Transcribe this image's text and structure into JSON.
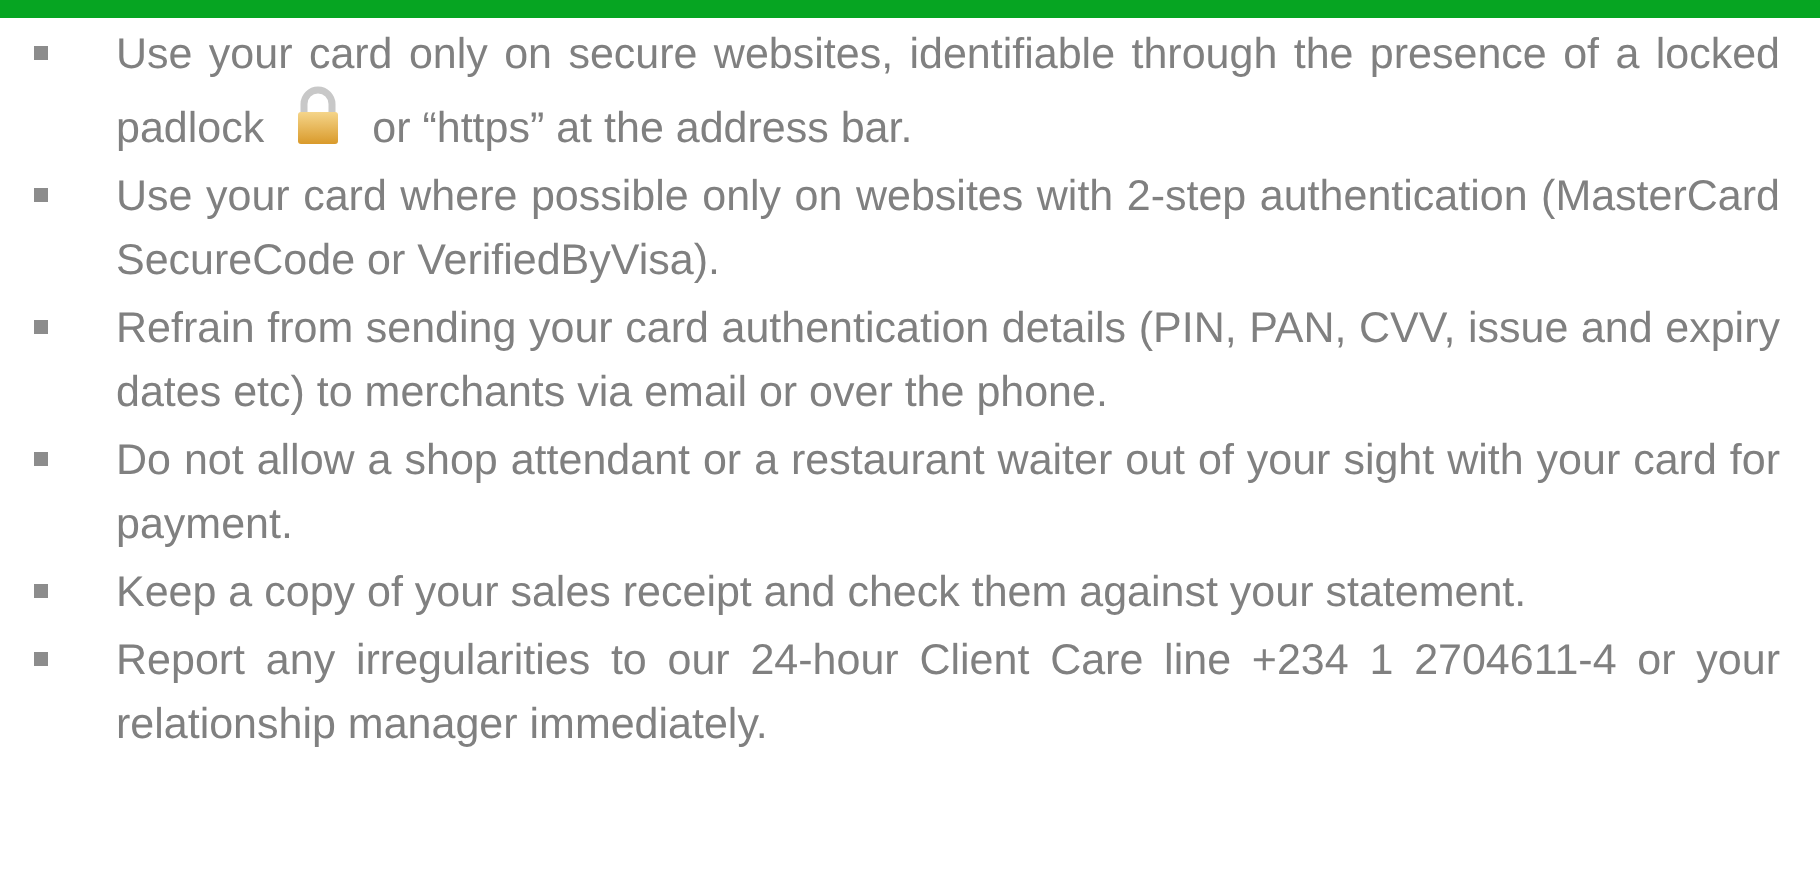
{
  "header_bar": {
    "visible": true
  },
  "tips": [
    {
      "text": "Use your card only on secure websites, identifiable through the presence of a locked padlock",
      "text_after": "or “https” at the address bar."
    },
    {
      "text": "Use your card where possible only on websites with 2-step authentication (MasterCard SecureCode or VerifiedByVisa)."
    },
    {
      "text": "Refrain from sending your card authentication details (PIN, PAN, CVV, issue and expiry dates etc) to merchants via email or over the phone."
    },
    {
      "text": "Do not allow a shop attendant or a restaurant waiter out of your sight with your card for payment."
    },
    {
      "text": "Keep a copy of your sales receipt and check them against your statement."
    },
    {
      "text": "Report any irregularities to our 24-hour Client Care line +234 1 2704611-4 or your relationship manager immediately."
    }
  ]
}
